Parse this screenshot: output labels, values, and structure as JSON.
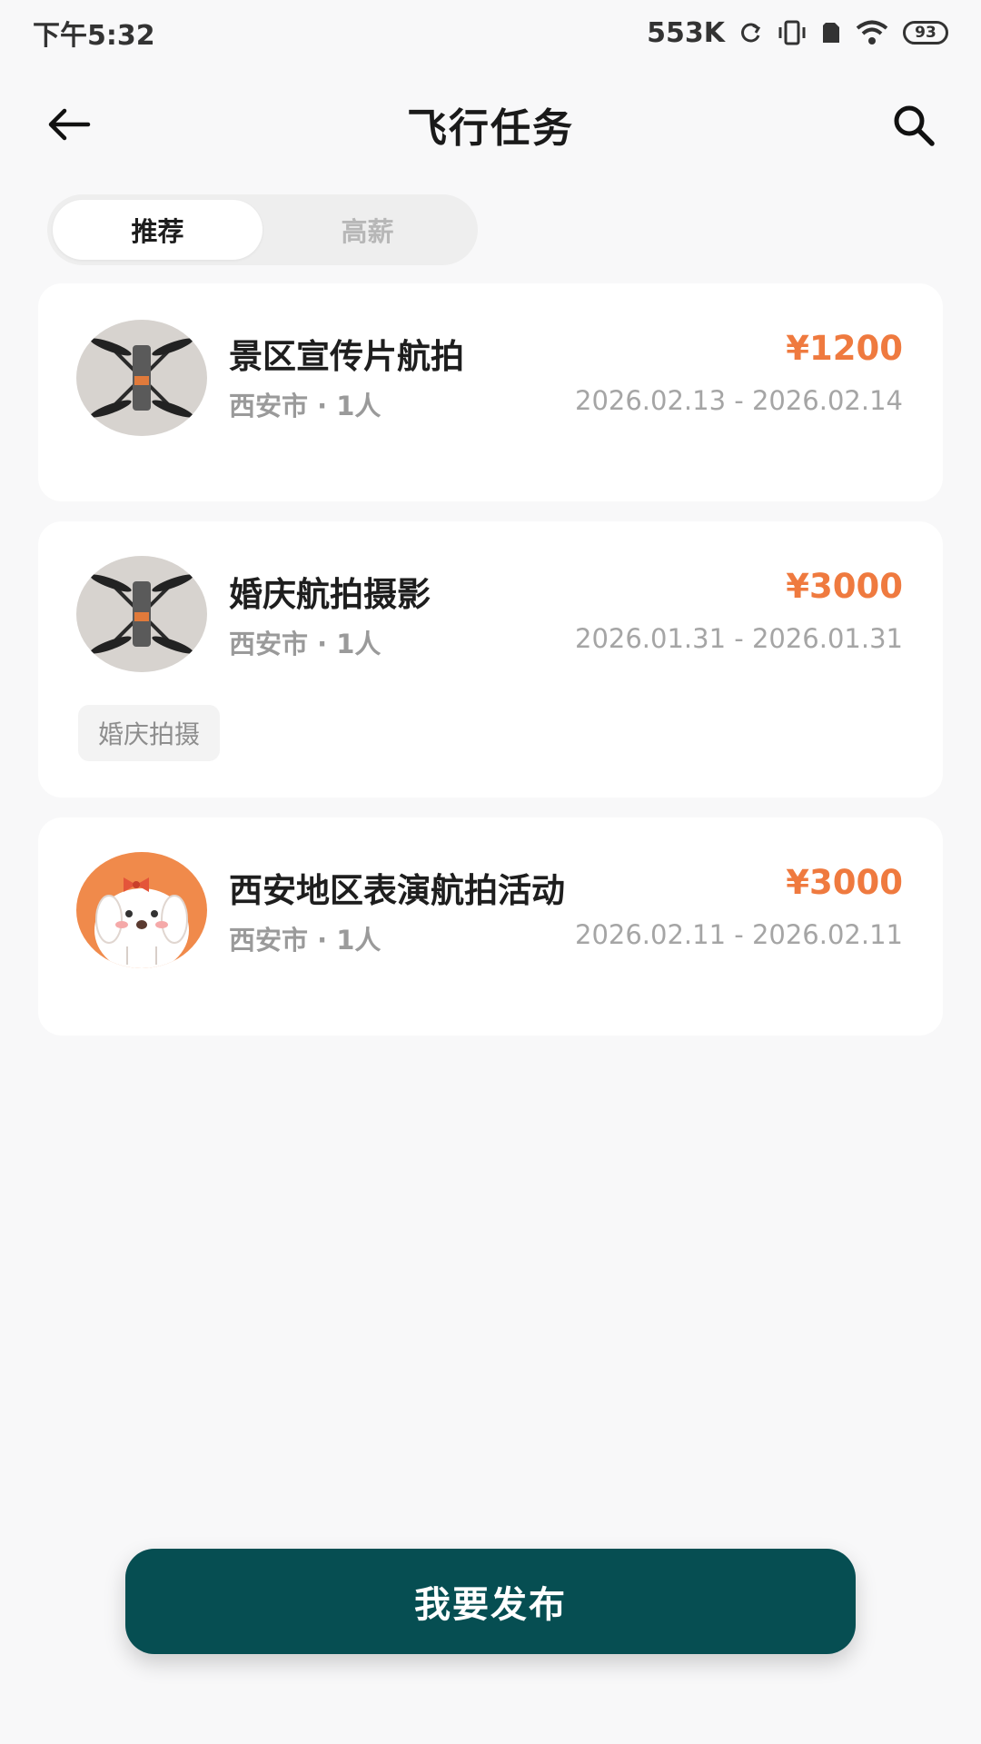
{
  "status_bar": {
    "time": "下午5:32",
    "net_speed": "553K",
    "battery": "93"
  },
  "header": {
    "title": "飞行任务"
  },
  "tabs": [
    {
      "label": "推荐",
      "active": true
    },
    {
      "label": "高薪",
      "active": false
    }
  ],
  "tasks": [
    {
      "title": "景区宣传片航拍",
      "price": "¥1200",
      "meta": "西安市 · 1人",
      "dates": "2026.02.13 - 2026.02.14",
      "avatar": "drone-photo"
    },
    {
      "title": "婚庆航拍摄影",
      "price": "¥3000",
      "meta": "西安市 · 1人",
      "dates": "2026.01.31 - 2026.01.31",
      "tag": "婚庆拍摄",
      "avatar": "drone-photo"
    },
    {
      "title": "西安地区表演航拍活动",
      "price": "¥3000",
      "meta": "西安市 · 1人",
      "dates": "2026.02.11 - 2026.02.11",
      "avatar": "cartoon-dog"
    }
  ],
  "publish_button": "我要发布",
  "colors": {
    "accent": "#064e52",
    "price": "#ef7a3f",
    "background": "#f8f8f9"
  }
}
